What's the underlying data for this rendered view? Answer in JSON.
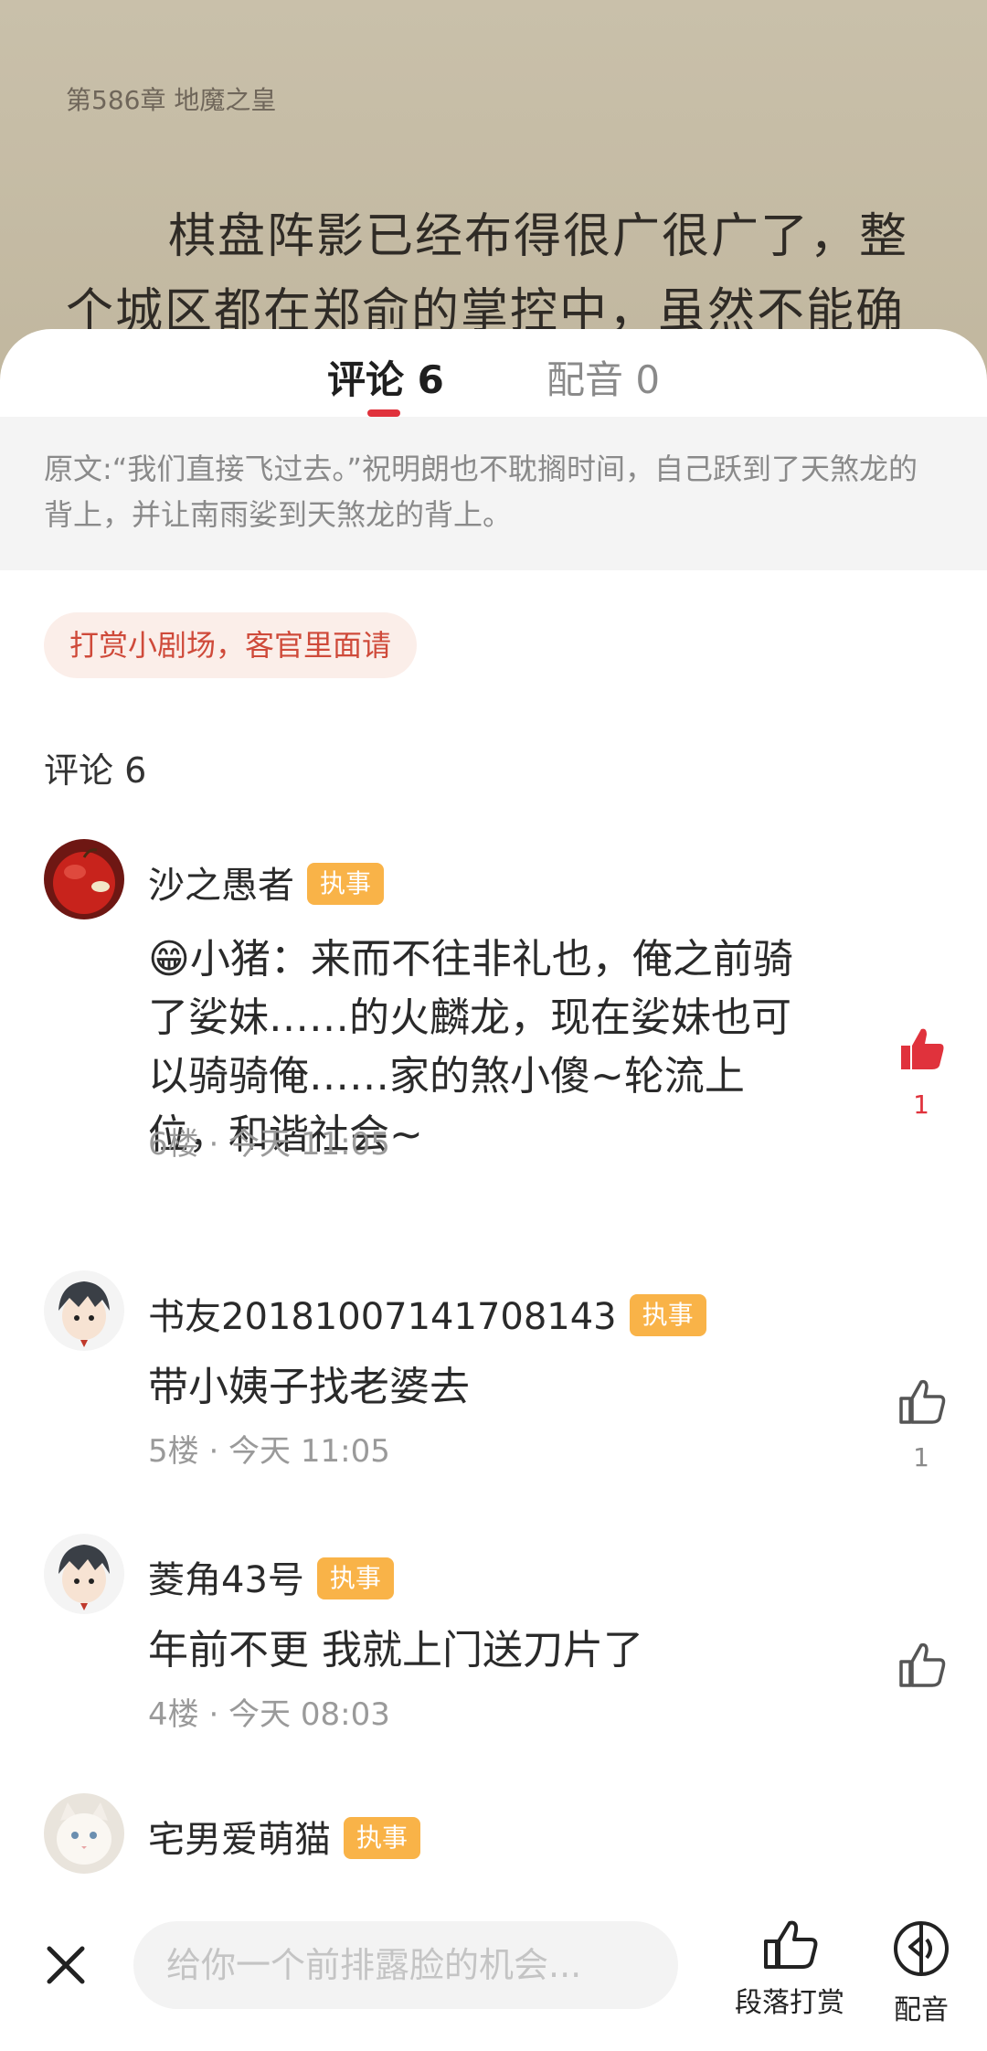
{
  "reader": {
    "chapter_title": "第586章 地魔之皇",
    "text": "棋盘阵影已经布得很广很广了，整个城区都在郑俞的掌控中，虽然不能确"
  },
  "tabs": [
    {
      "label": "评论 6"
    },
    {
      "label": "配音 0"
    }
  ],
  "quote": "原文:“我们直接飞过去。”祝明朗也不耽搁时间，自己跃到了天煞龙的背上，并让南雨娑到天煞龙的背上。",
  "reward_banner": "打赏小剧场，客官里面请",
  "section_heading": "评论 6",
  "colors": {
    "accent": "#e0323c",
    "badge": "#f9b348",
    "liked": "#e0323c",
    "muted": "#9a9a9a"
  },
  "comments": [
    {
      "user": "沙之愚者",
      "badge": "执事",
      "text": "😁小猪：来而不往非礼也，俺之前骑了娑妹……的火麟龙，现在娑妹也可以骑骑俺……家的煞小傻~轮流上位，和谐社会~",
      "meta": "6楼 · 今天 11:05",
      "likes": "1",
      "liked": true,
      "avatar_icon": "apple-avatar"
    },
    {
      "user": "书友20181007141708143",
      "badge": "执事",
      "text": "带小姨子找老婆去",
      "meta": "5楼 · 今天 11:05",
      "likes": "1",
      "liked": false,
      "avatar_icon": "anime-boy-avatar"
    },
    {
      "user": "菱角43号",
      "badge": "执事",
      "text": "年前不更 我就上门送刀片了",
      "meta": "4楼 · 今天 08:03",
      "likes": "",
      "liked": false,
      "avatar_icon": "anime-boy-avatar"
    },
    {
      "user": "宅男爱萌猫",
      "badge": "执事",
      "avatar_icon": "kitten-avatar"
    }
  ],
  "bottom_bar": {
    "input_placeholder": "给你一个前排露脸的机会...",
    "tip_label": "段落打赏",
    "dub_label": "配音"
  }
}
